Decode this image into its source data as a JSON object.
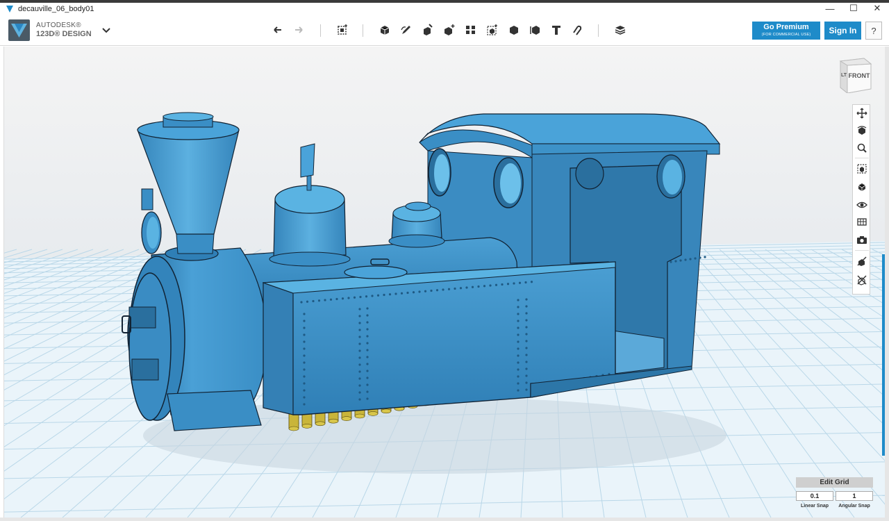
{
  "window": {
    "title": "decauville_06_body01",
    "controls": {
      "minimize": "—",
      "maximize": "☐",
      "close": "✕"
    }
  },
  "brand": {
    "line1": "AUTODESK®",
    "line2": "123D® DESIGN"
  },
  "toolbar": {
    "tools": [
      {
        "name": "undo-icon"
      },
      {
        "name": "redo-icon"
      },
      {
        "name": "transform-icon"
      },
      {
        "name": "primitives-icon"
      },
      {
        "name": "sketch-icon"
      },
      {
        "name": "construct-icon"
      },
      {
        "name": "modify-icon"
      },
      {
        "name": "pattern-icon"
      },
      {
        "name": "grouping-icon"
      },
      {
        "name": "combine-icon"
      },
      {
        "name": "measure-icon"
      },
      {
        "name": "text-icon"
      },
      {
        "name": "snap-icon"
      },
      {
        "name": "material-icon"
      }
    ],
    "premium": {
      "label": "Go Premium",
      "sublabel": "(FOR COMMERCIAL USE)"
    },
    "signin_label": "Sign In",
    "help_label": "?"
  },
  "viewcube": {
    "front_label": "FRONT",
    "left_label": "LT"
  },
  "navbar": {
    "items": [
      "pan-icon",
      "orbit-icon",
      "zoom-icon",
      "fit-icon",
      "views-icon",
      "visibility-icon",
      "material-toggle-icon",
      "screenshot-icon",
      "snap-on-icon",
      "snap-off-icon"
    ]
  },
  "grid": {
    "edit_label": "Edit Grid",
    "linear_value": "0.1",
    "angular_value": "1",
    "linear_label": "Linear Snap",
    "angular_label": "Angular Snap"
  },
  "colors": {
    "accent": "#1e8bc9",
    "model": "#3e92c9",
    "model_dark": "#2c76a8",
    "wheels": "#c9b53a",
    "grid": "#b9d7e8"
  }
}
